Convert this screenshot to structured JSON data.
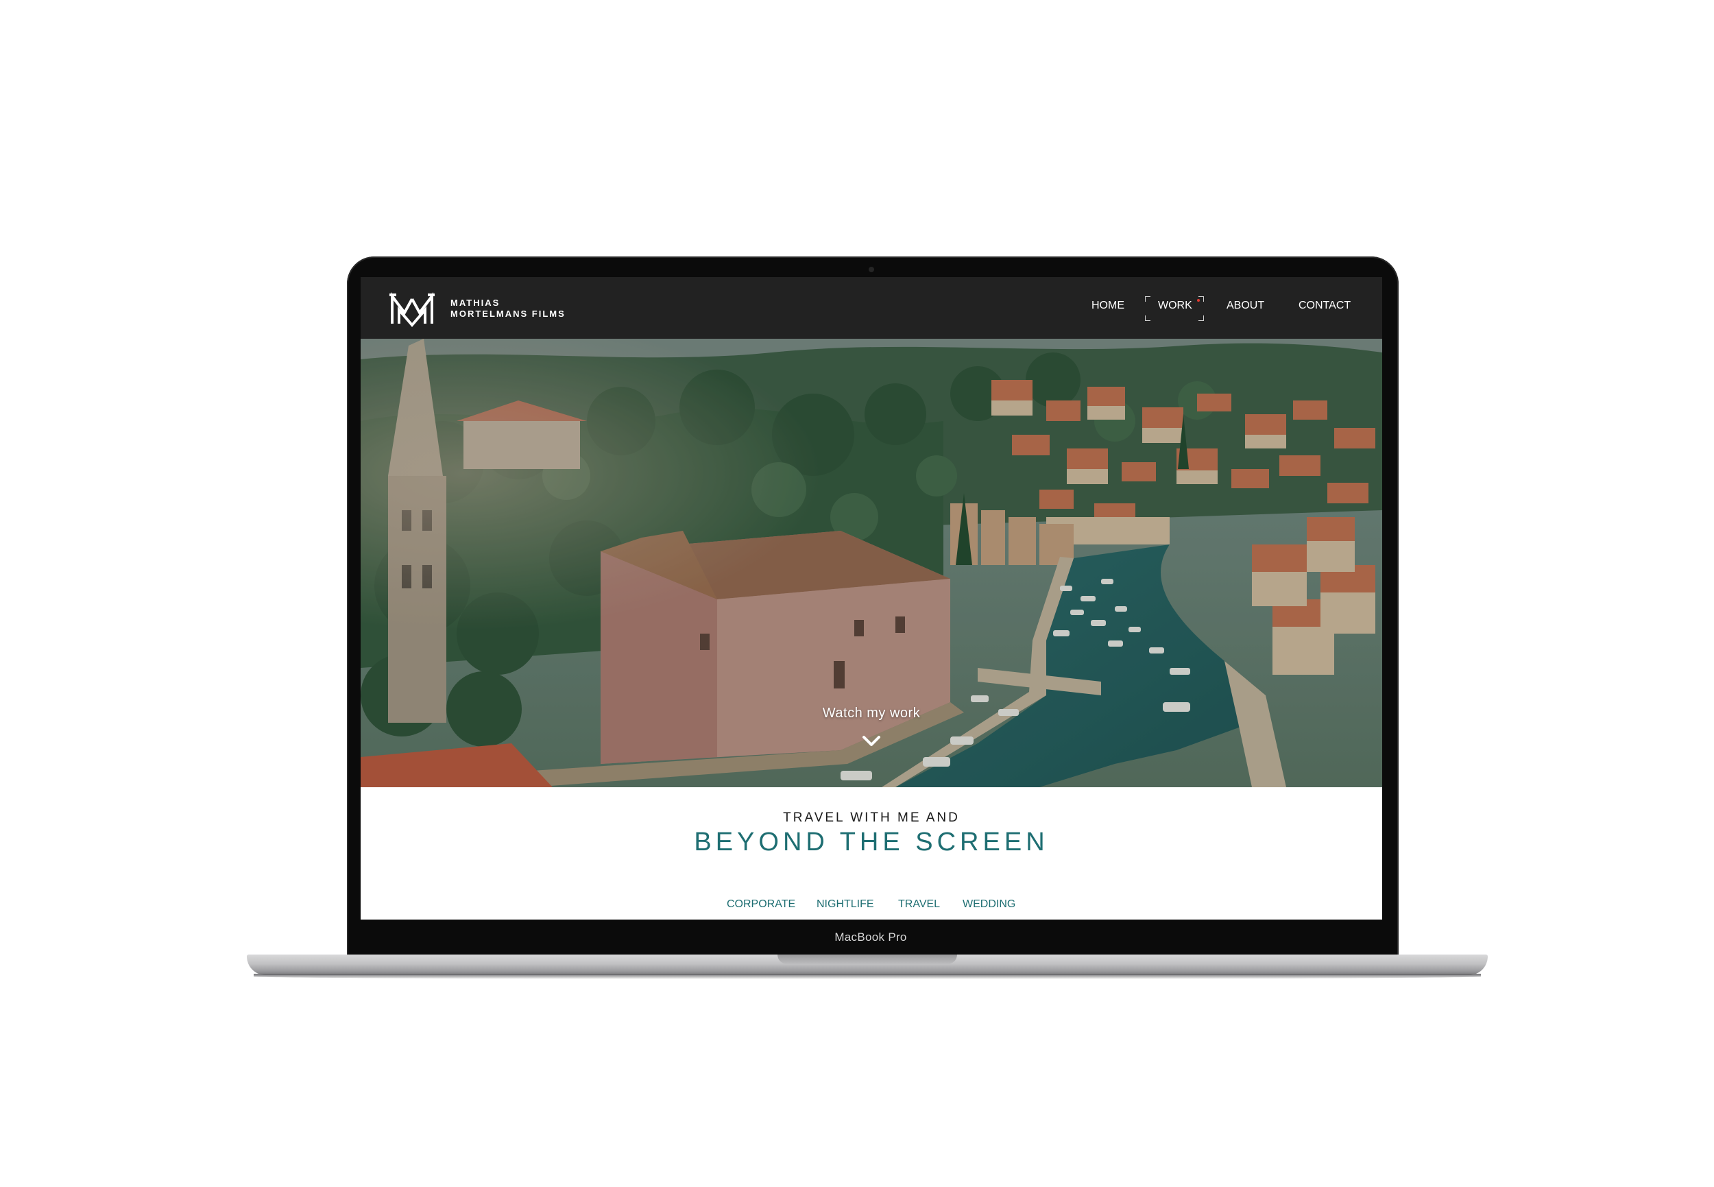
{
  "device": {
    "label": "MacBook Pro"
  },
  "site": {
    "brand_line1": "MATHIAS",
    "brand_line2": "MORTELMANS FILMS",
    "nav": {
      "home": "HOME",
      "work": "WORK",
      "about": "ABOUT",
      "contact": "CONTACT",
      "active": "WORK"
    },
    "hero": {
      "cta": "Watch my work"
    },
    "intro": {
      "small": "TRAVEL WITH ME AND",
      "big": "BEYOND THE SCREEN"
    },
    "filters": {
      "corporate": "CORPORATE",
      "nightlife": "NIGHTLIFE",
      "travel": "TRAVEL",
      "wedding": "WEDDING"
    }
  },
  "colors": {
    "header_bg": "#222222",
    "accent_teal": "#1e6e72",
    "active_dot": "#e03a2f"
  },
  "icons": {
    "logo": "mm-monogram-logo",
    "scroll": "chevron-down-icon"
  }
}
